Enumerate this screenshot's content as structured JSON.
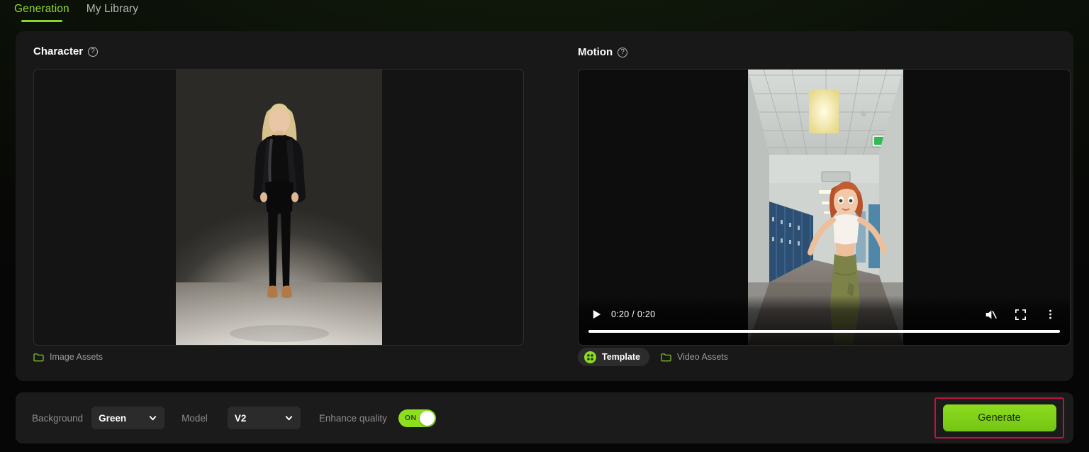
{
  "tabs": [
    {
      "label": "Generation",
      "active": true
    },
    {
      "label": "My Library",
      "active": false
    }
  ],
  "character": {
    "title": "Character",
    "help_icon": "question-circle-icon",
    "assets_label": "Image Assets",
    "assets_icon": "folder-icon"
  },
  "motion": {
    "title": "Motion",
    "help_icon": "question-circle-icon",
    "template_label": "Template",
    "template_icon": "template-grid-icon",
    "assets_label": "Video Assets",
    "assets_icon": "folder-icon",
    "player": {
      "play_icon": "play-icon",
      "time": "0:20 / 0:20",
      "current_time": "0:20",
      "duration": "0:20",
      "mute_icon": "volume-muted-icon",
      "fullscreen_icon": "fullscreen-icon",
      "more_icon": "kebab-menu-icon",
      "progress_percent": 100
    }
  },
  "toolbar": {
    "background_label": "Background",
    "background_value": "Green",
    "model_label": "Model",
    "model_value": "V2",
    "enhance_label": "Enhance quality",
    "enhance_state": "ON",
    "generate_label": "Generate"
  },
  "colors": {
    "accent_green": "#8fd929",
    "button_green": "#8cdc1f",
    "highlight_red": "#c01440",
    "panel_bg": "#181818",
    "bottom_bg": "#1b1b1b"
  }
}
